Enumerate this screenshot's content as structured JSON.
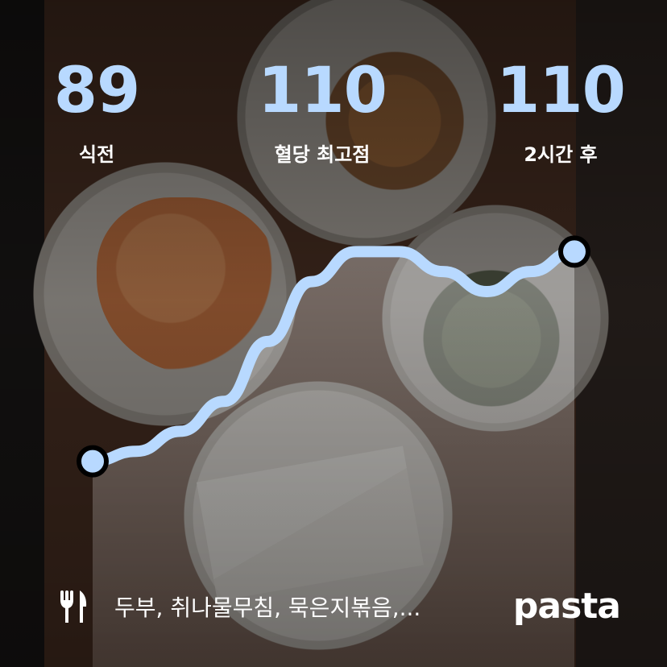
{
  "stats": {
    "before": {
      "value": "89",
      "label": "식전"
    },
    "peak": {
      "value": "110",
      "label": "혈당 최고점"
    },
    "after": {
      "value": "110",
      "label": "2시간 후"
    }
  },
  "chart_data": {
    "type": "line",
    "series": [
      {
        "values": [
          89,
          90,
          92,
          95,
          101,
          107,
          110,
          110,
          108,
          106,
          108,
          110
        ]
      }
    ],
    "start_marker": "filled-circle",
    "end_marker": "filled-circle",
    "color": "#b8d9ff"
  },
  "footer": {
    "food_icon": "fork-knife-icon",
    "foods": "두부, 취나물무침, 묵은지볶음,...",
    "brand": "pasta"
  }
}
